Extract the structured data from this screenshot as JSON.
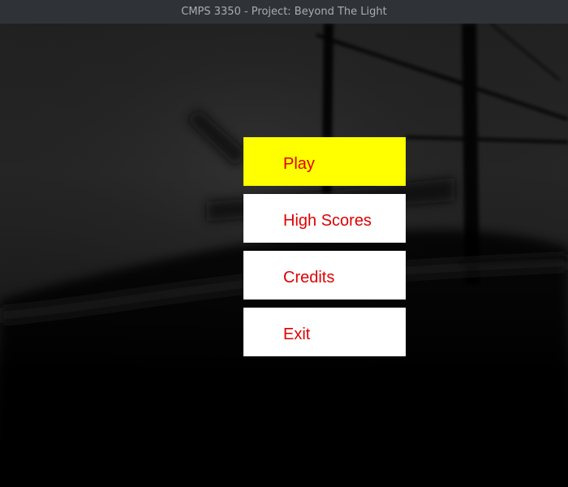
{
  "window": {
    "title": "CMPS 3350 - Project: Beyond The Light"
  },
  "menu": {
    "items": [
      {
        "label": "Play",
        "selected": true
      },
      {
        "label": "High Scores",
        "selected": false
      },
      {
        "label": "Credits",
        "selected": false
      },
      {
        "label": "Exit",
        "selected": false
      }
    ]
  },
  "colors": {
    "titlebar_bg": "#2f3338",
    "titlebar_text": "#a8adb3",
    "button_bg": "#ffffff",
    "button_selected_bg": "#ffff00",
    "button_text": "#e00000"
  }
}
